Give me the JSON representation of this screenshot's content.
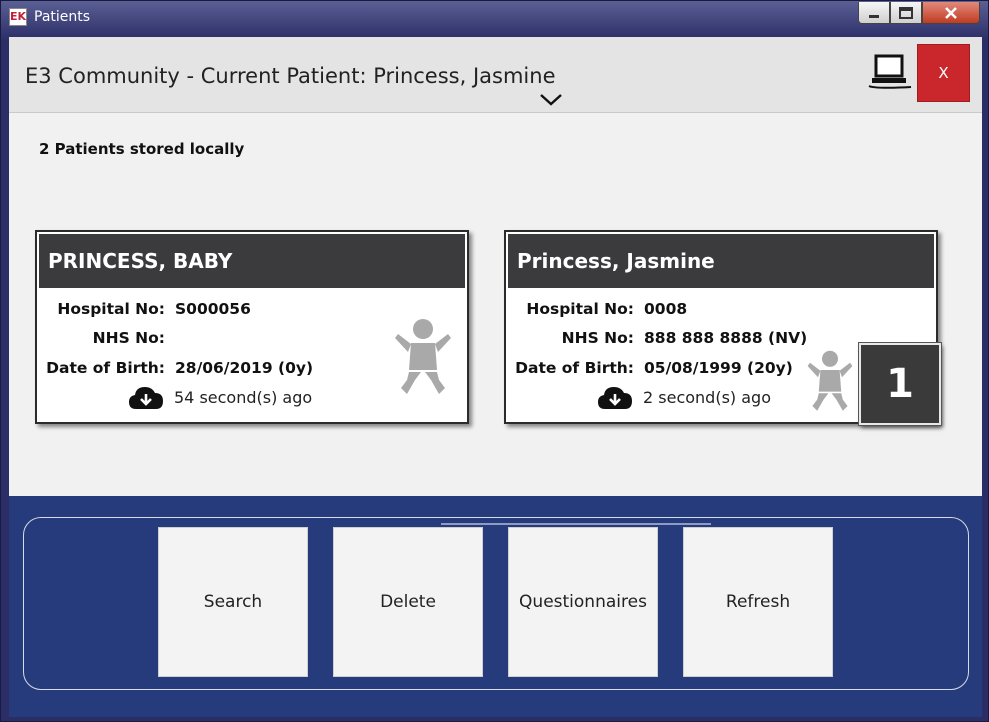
{
  "window": {
    "title": "Patients",
    "app_icon": "EK"
  },
  "header": {
    "title": "E3 Community - Current Patient: Princess, Jasmine",
    "close_label": "X"
  },
  "summary": "2 Patients stored locally",
  "labels": {
    "hospital_no": "Hospital No:",
    "nhs_no": "NHS No:",
    "dob": "Date of Birth:"
  },
  "patients": [
    {
      "name": "PRINCESS, BABY",
      "hospital_no": "S000056",
      "nhs_no": "",
      "dob": "28/06/2019 (0y)",
      "synced": "54 second(s) ago"
    },
    {
      "name": "Princess, Jasmine",
      "hospital_no": "0008",
      "nhs_no": "888 888 8888 (NV)",
      "dob": "05/08/1999 (20y)",
      "synced": "2 second(s) ago",
      "badge": "1"
    }
  ],
  "toolbar": [
    "Search",
    "Delete",
    "Questionnaires",
    "Refresh"
  ],
  "colors": {
    "header_bar": "#e4e4e4",
    "card_header": "#3b3b3d",
    "close_red": "#c9272b",
    "toolbar_blue": "#253b7b"
  }
}
